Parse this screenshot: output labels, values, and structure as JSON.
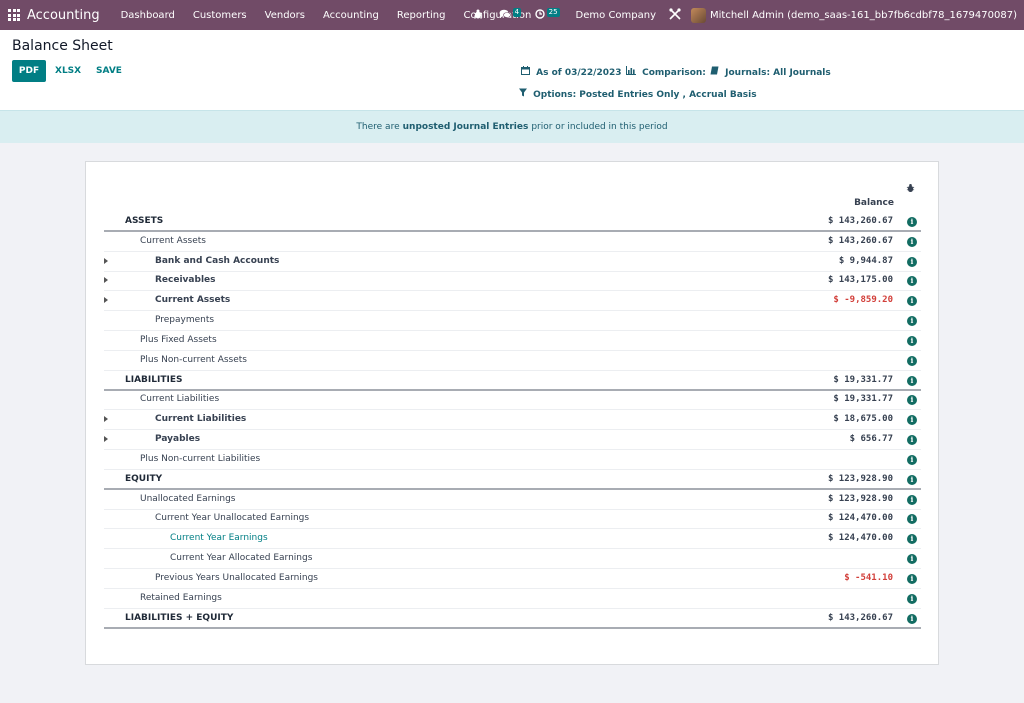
{
  "navbar": {
    "brand": "Accounting",
    "menu": [
      "Dashboard",
      "Customers",
      "Vendors",
      "Accounting",
      "Reporting",
      "Configuration"
    ],
    "chat_count": "4",
    "activity_count": "25",
    "company": "Demo Company",
    "user": "Mitchell Admin (demo_saas-161_bb7fb6cdbf78_1679470087)"
  },
  "control_panel": {
    "title": "Balance Sheet",
    "buttons": {
      "pdf": "PDF",
      "xlsx": "XLSX",
      "save": "SAVE"
    },
    "date_filter": "As of 03/22/2023",
    "comparison": "Comparison:",
    "journals": "Journals: All Journals",
    "options": "Options: Posted Entries Only , Accrual Basis"
  },
  "warning": {
    "prefix": "There are",
    "link": "unposted Journal Entries",
    "suffix": "prior or included in this period"
  },
  "report": {
    "column_header": "Balance",
    "rows": [
      {
        "label": "ASSETS",
        "amount": "$ 143,260.67",
        "level": "l0",
        "style": "section",
        "caret": false
      },
      {
        "label": "Current Assets",
        "amount": "$ 143,260.67",
        "level": "l1",
        "style": "",
        "caret": false
      },
      {
        "label": "Bank and Cash Accounts",
        "amount": "$ 9,944.87",
        "level": "l2b",
        "style": "",
        "caret": true
      },
      {
        "label": "Receivables",
        "amount": "$ 143,175.00",
        "level": "l2b",
        "style": "",
        "caret": true
      },
      {
        "label": "Current Assets",
        "amount": "$ -9,859.20",
        "level": "l2b",
        "style": "",
        "caret": true,
        "negative": true
      },
      {
        "label": "Prepayments",
        "amount": "",
        "level": "l2",
        "style": "",
        "caret": false
      },
      {
        "label": "Plus Fixed Assets",
        "amount": "",
        "level": "l1",
        "style": "",
        "caret": false
      },
      {
        "label": "Plus Non-current Assets",
        "amount": "",
        "level": "l1",
        "style": "",
        "caret": false
      },
      {
        "label": "LIABILITIES",
        "amount": "$ 19,331.77",
        "level": "l0",
        "style": "section",
        "caret": false
      },
      {
        "label": "Current Liabilities",
        "amount": "$ 19,331.77",
        "level": "l1",
        "style": "",
        "caret": false
      },
      {
        "label": "Current Liabilities",
        "amount": "$ 18,675.00",
        "level": "l2b",
        "style": "",
        "caret": true
      },
      {
        "label": "Payables",
        "amount": "$ 656.77",
        "level": "l2b",
        "style": "",
        "caret": true
      },
      {
        "label": "Plus Non-current Liabilities",
        "amount": "",
        "level": "l1",
        "style": "",
        "caret": false
      },
      {
        "label": "EQUITY",
        "amount": "$ 123,928.90",
        "level": "l0",
        "style": "section",
        "caret": false
      },
      {
        "label": "Unallocated Earnings",
        "amount": "$ 123,928.90",
        "level": "l1",
        "style": "",
        "caret": false
      },
      {
        "label": "Current Year Unallocated Earnings",
        "amount": "$ 124,470.00",
        "level": "l2",
        "style": "",
        "caret": false
      },
      {
        "label": "Current Year Earnings",
        "amount": "$ 124,470.00",
        "level": "l3link",
        "style": "",
        "caret": false
      },
      {
        "label": "Current Year Allocated Earnings",
        "amount": "",
        "level": "l3",
        "style": "",
        "caret": false
      },
      {
        "label": "Previous Years Unallocated Earnings",
        "amount": "$ -541.10",
        "level": "l2",
        "style": "",
        "caret": false,
        "negative": true
      },
      {
        "label": "Retained Earnings",
        "amount": "",
        "level": "l1",
        "style": "",
        "caret": false
      },
      {
        "label": "LIABILITIES + EQUITY",
        "amount": "$ 143,260.67",
        "level": "l0",
        "style": "total",
        "caret": false
      }
    ]
  }
}
